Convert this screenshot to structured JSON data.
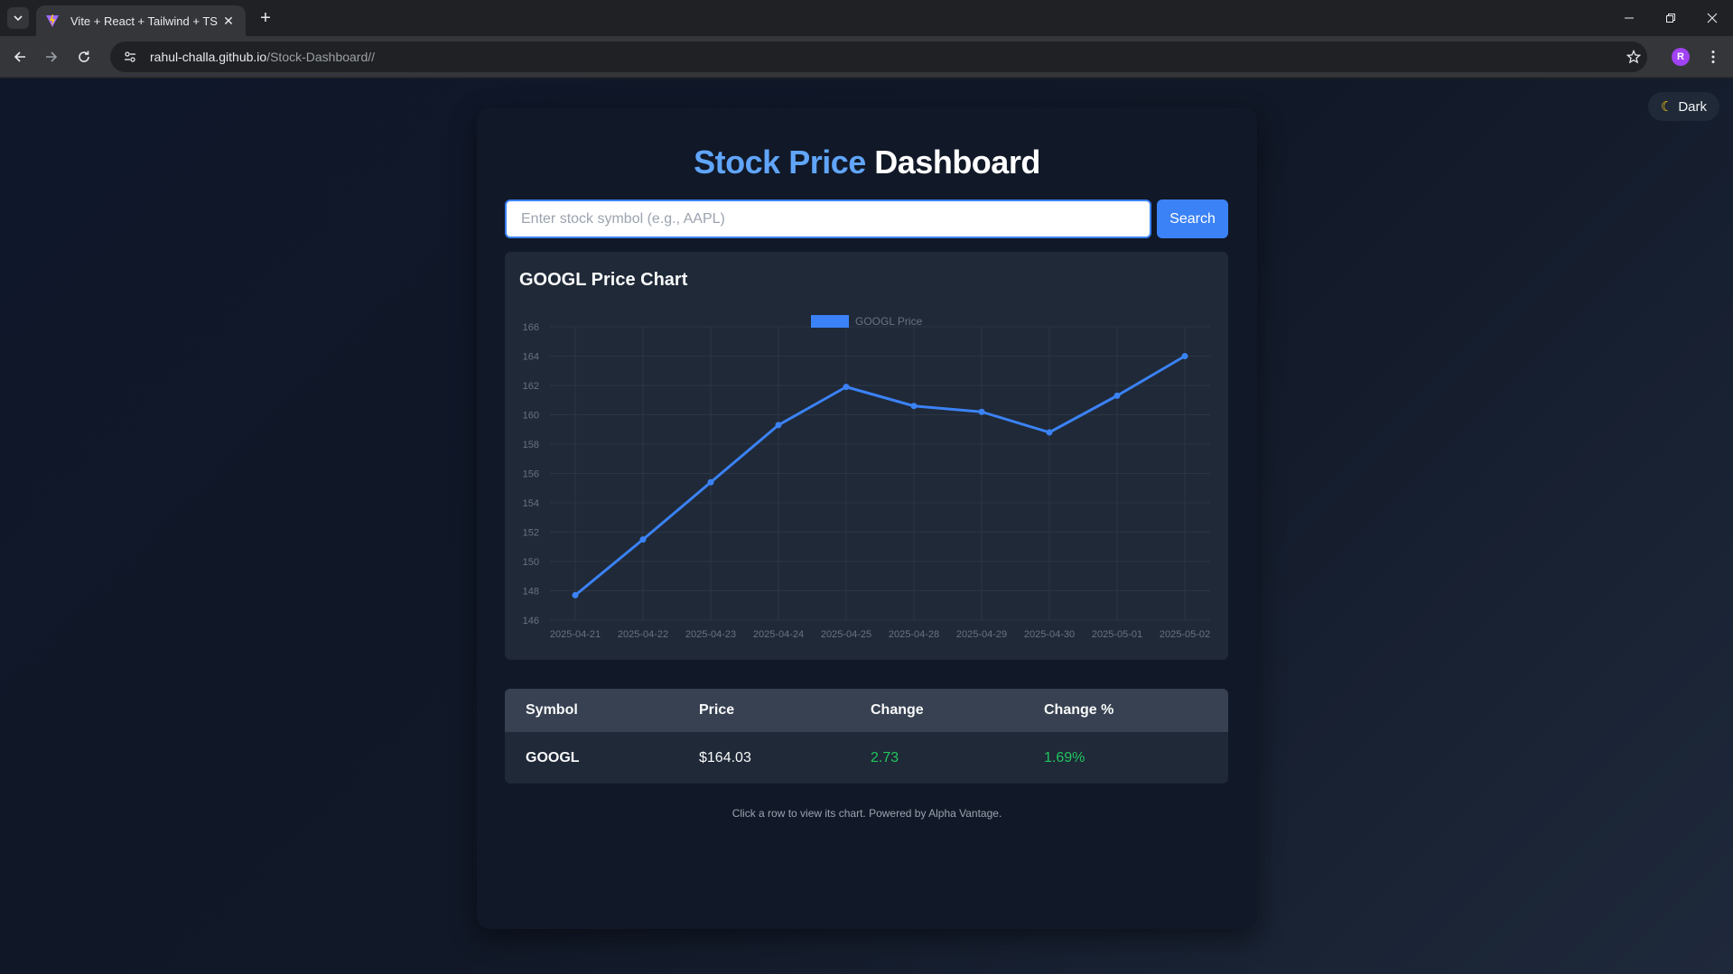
{
  "browser": {
    "tab_title": "Vite + React + Tailwind + TS",
    "url_host": "rahul-challa.github.io",
    "url_path": "/Stock-Dashboard//",
    "profile_initial": "R"
  },
  "page": {
    "theme_toggle_label": "Dark",
    "title_accent": "Stock Price",
    "title_rest": "Dashboard",
    "search_placeholder": "Enter stock symbol (e.g., AAPL)",
    "search_button_label": "Search",
    "chart_title": "GOOGL Price Chart",
    "footnote": "Click a row to view its chart. Powered by Alpha Vantage."
  },
  "table": {
    "headers": [
      "Symbol",
      "Price",
      "Change",
      "Change %"
    ],
    "rows": [
      {
        "symbol": "GOOGL",
        "price": "$164.03",
        "change": "2.73",
        "change_pct": "1.69%"
      }
    ]
  },
  "colors": {
    "accent": "#3b82f6",
    "title_accent": "#60a5fa",
    "positive": "#22c55e"
  },
  "chart_data": {
    "type": "line",
    "title": "",
    "xlabel": "",
    "ylabel": "",
    "categories": [
      "2025-04-21",
      "2025-04-22",
      "2025-04-23",
      "2025-04-24",
      "2025-04-25",
      "2025-04-28",
      "2025-04-29",
      "2025-04-30",
      "2025-05-01",
      "2025-05-02"
    ],
    "series": [
      {
        "name": "GOOGL Price",
        "color": "#3b82f6",
        "values": [
          147.7,
          151.5,
          155.4,
          159.3,
          161.9,
          160.6,
          160.2,
          158.8,
          161.3,
          164.0
        ]
      }
    ],
    "ylim": [
      146,
      166
    ],
    "yticks": [
      146,
      148,
      150,
      152,
      154,
      156,
      158,
      160,
      162,
      164,
      166
    ],
    "legend": "top-center",
    "grid": true
  }
}
